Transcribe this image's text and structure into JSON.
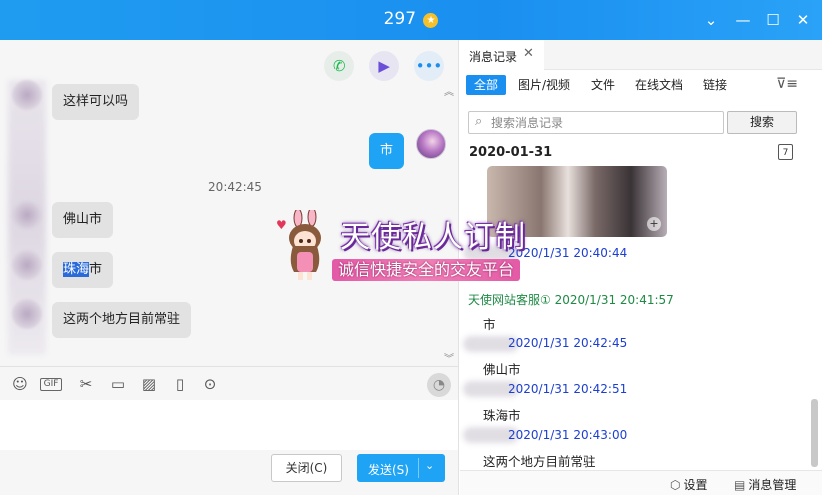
{
  "window": {
    "title": "297",
    "title_badge": "★",
    "controls": {
      "minimize": "⌄",
      "restore": "—",
      "maximize": "☐",
      "close": "✕"
    }
  },
  "chat": {
    "messages": [
      {
        "from": "them",
        "text": "这样可以吗"
      },
      {
        "from": "me",
        "text": "市"
      },
      {
        "type": "time",
        "text": "20:42:45"
      },
      {
        "from": "them",
        "text": "佛山市"
      },
      {
        "from": "them",
        "text_selected": "珠海",
        "text_rest": "市"
      },
      {
        "from": "them",
        "text": "这两个地方目前常驻"
      }
    ],
    "top_icons": [
      "phone-icon",
      "video-icon",
      "more-icon"
    ],
    "toolbar_icons": [
      "emoji-icon",
      "gif-icon",
      "scissors-icon",
      "folder-icon",
      "image-icon",
      "vibrate-icon",
      "more-circle-icon"
    ],
    "gif_label": "GIF",
    "close_label": "关闭(C)",
    "send_label": "发送(S)"
  },
  "banner": {
    "title": "天使私人订制",
    "subtitle": "诚信快捷安全的交友平台"
  },
  "history": {
    "tab_label": "消息记录",
    "filters": [
      "全部",
      "图片/视频",
      "文件",
      "在线文档",
      "链接"
    ],
    "search_placeholder": "搜索消息记录",
    "search_button": "搜索",
    "date": "2020-01-31",
    "calendar_glyph": "7",
    "entries": [
      {
        "meta": "2020/1/31 20:40:44",
        "text": ""
      },
      {
        "meta": "天使网站客服① 2020/1/31 20:41:57",
        "text": "市"
      },
      {
        "meta": "2020/1/31 20:42:45",
        "text": "佛山市"
      },
      {
        "meta": "2020/1/31 20:42:51",
        "text": "珠海市"
      },
      {
        "meta": "2020/1/31 20:43:00",
        "text": "这两个地方目前常驻"
      }
    ],
    "footer": {
      "settings": "设置",
      "manage": "消息管理"
    }
  },
  "colors": {
    "accent": "#1a8ff0",
    "bubble_mine": "#1fa3f4",
    "meta_blue": "#1c3fd1",
    "meta_green": "#1e8a44"
  }
}
